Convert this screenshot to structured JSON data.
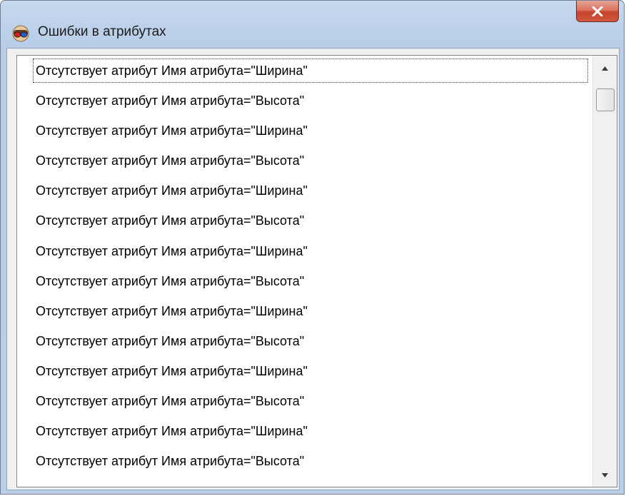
{
  "window": {
    "title": "Ошибки в атрибутах",
    "close_label": "x"
  },
  "list": {
    "items": [
      "Отсутствует атрибут Имя атрибута=\"Ширина\"",
      "Отсутствует атрибут Имя атрибута=\"Высота\"",
      "Отсутствует атрибут Имя атрибута=\"Ширина\"",
      "Отсутствует атрибут Имя атрибута=\"Высота\"",
      "Отсутствует атрибут Имя атрибута=\"Ширина\"",
      "Отсутствует атрибут Имя атрибута=\"Высота\"",
      "Отсутствует атрибут Имя атрибута=\"Ширина\"",
      "Отсутствует атрибут Имя атрибута=\"Высота\"",
      "Отсутствует атрибут Имя атрибута=\"Ширина\"",
      "Отсутствует атрибут Имя атрибута=\"Высота\"",
      "Отсутствует атрибут Имя атрибута=\"Ширина\"",
      "Отсутствует атрибут Имя атрибута=\"Высота\"",
      "Отсутствует атрибут Имя атрибута=\"Ширина\"",
      "Отсутствует атрибут Имя атрибута=\"Высота\""
    ],
    "focused_index": 0
  },
  "scrollbar": {
    "position_fraction": 0.0
  },
  "icons": {
    "app": "stereo-glasses-icon",
    "close": "close-icon",
    "scroll_up": "scroll-up-arrow-icon",
    "scroll_down": "scroll-down-arrow-icon"
  },
  "colors": {
    "titlebar": "#c7d9ee",
    "close_button": "#c5432b",
    "list_background": "#ffffff",
    "text": "#000000"
  }
}
